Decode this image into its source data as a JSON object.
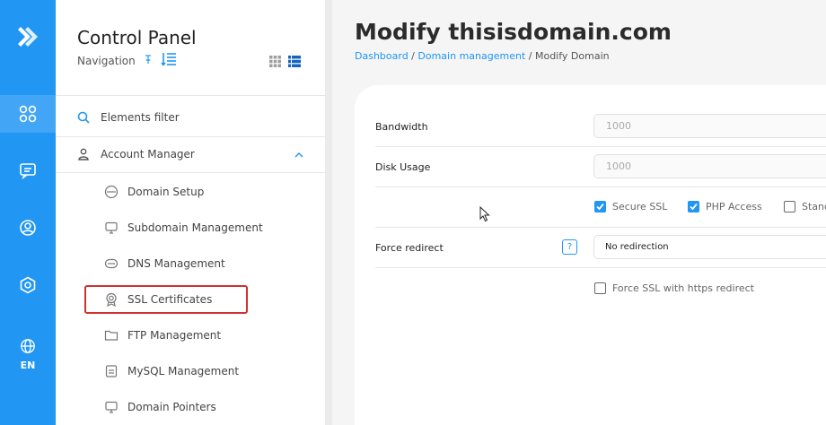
{
  "rail": {
    "lang": "EN",
    "icons": [
      "logo-icon",
      "apps-icon",
      "message-icon",
      "user-circle-icon",
      "settings-icon",
      "globe-icon"
    ]
  },
  "nav": {
    "title": "Control Panel",
    "subtitle": "Navigation",
    "filter_label": "Elements filter",
    "section_label": "Account Manager",
    "items": [
      {
        "label": "Domain Setup"
      },
      {
        "label": "Subdomain Management"
      },
      {
        "label": "DNS Management"
      },
      {
        "label": "SSL Certificates"
      },
      {
        "label": "FTP Management"
      },
      {
        "label": "MySQL Management"
      },
      {
        "label": "Domain Pointers"
      }
    ]
  },
  "page": {
    "title": "Modify thisisdomain.com",
    "breadcrumb": {
      "home": "Dashboard",
      "section": "Domain management",
      "current": "Modify Domain",
      "separator": " / "
    }
  },
  "form": {
    "bandwidth_label": "Bandwidth",
    "bandwidth_placeholder": "1000",
    "disk_label": "Disk Usage",
    "disk_placeholder": "1000",
    "checks": [
      {
        "label": "Secure SSL",
        "checked": true
      },
      {
        "label": "PHP Access",
        "checked": true
      },
      {
        "label": "Stanc",
        "checked": false
      }
    ],
    "redirect_label": "Force redirect",
    "help_label": "?",
    "redirect_value": "No redirection",
    "force_ssl_label": "Force SSL with https redirect"
  },
  "colors": {
    "accent": "#2196f3",
    "rail_active": "#42a5f5",
    "highlight": "#d32f2f"
  }
}
